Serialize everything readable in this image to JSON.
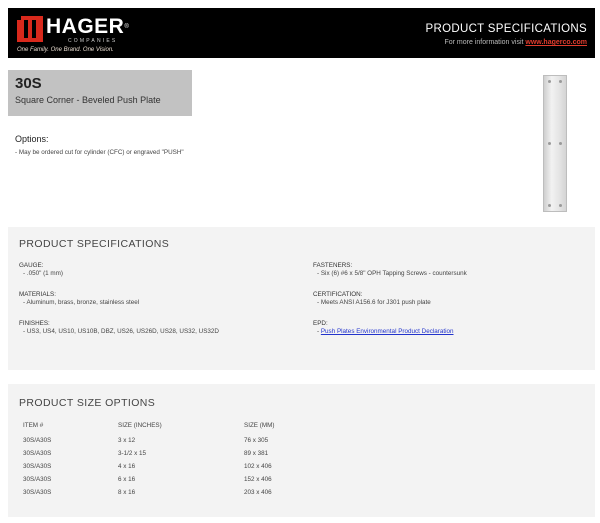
{
  "header": {
    "logo_name": "HAGER",
    "logo_sub": "COMPANIES",
    "tagline": "One Family.  One Brand.  One Vision.",
    "title": "PRODUCT SPECIFICATIONS",
    "more_info_prefix": "For more information visit ",
    "more_info_link": "www.hagerco.com"
  },
  "product": {
    "code": "30S",
    "description": "Square Corner - Beveled Push Plate"
  },
  "options": {
    "heading": "Options:",
    "line": "- May be ordered cut for cylinder (CFC) or engraved \"PUSH\""
  },
  "specs": {
    "heading": "PRODUCT SPECIFICATIONS",
    "gauge_label": "GAUGE:",
    "gauge_value": "- .050\" (1 mm)",
    "materials_label": "MATERIALS:",
    "materials_value": "- Aluminum, brass, bronze, stainless steel",
    "finishes_label": "FINISHES:",
    "finishes_value": "- US3, US4, US10, US10B, DBZ, US26, US26D, US28, US32, US32D",
    "fasteners_label": "FASTENERS:",
    "fasteners_value": "- Six (6) #6 x 5/8\" OPH Tapping Screws - countersunk",
    "certification_label": "CERTIFICATION:",
    "certification_value": "- Meets ANSI A156.6 for J301 push plate",
    "epd_label": "EPD:",
    "epd_prefix": "- ",
    "epd_link": "Push Plates Environmental Product Declaration"
  },
  "sizes": {
    "heading": "PRODUCT SIZE OPTIONS",
    "columns": [
      "ITEM #",
      "SIZE (INCHES)",
      "SIZE (MM)"
    ],
    "rows": [
      [
        "30S/A30S",
        "3 x 12",
        "76 x 305"
      ],
      [
        "30S/A30S",
        "3-1/2 x 15",
        "89 x 381"
      ],
      [
        "30S/A30S",
        "4 x 16",
        "102 x 406"
      ],
      [
        "30S/A30S",
        "6 x 16",
        "152 x 406"
      ],
      [
        "30S/A30S",
        "8 x 16",
        "203 x 406"
      ]
    ]
  },
  "colors": {
    "brand_red": "#d9291c",
    "header_bg": "#000000",
    "panel_bg": "#f3f3f3",
    "title_box_bg": "#c2c2c2"
  }
}
